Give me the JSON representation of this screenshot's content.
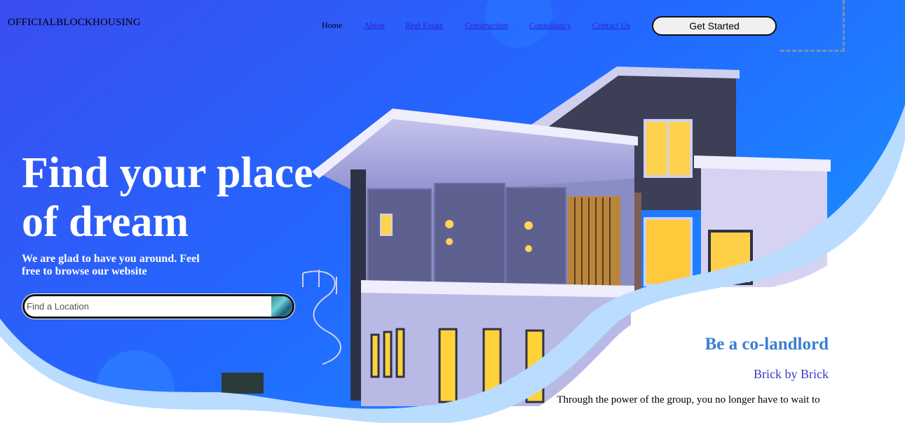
{
  "brand": {
    "logo": "OFFICIALBLOCKHOUSING"
  },
  "nav": {
    "items": [
      {
        "label": "Home"
      },
      {
        "label": "About"
      },
      {
        "label": "Real Estate"
      },
      {
        "label": "Construction"
      },
      {
        "label": "Consultancy"
      },
      {
        "label": "Contact Us"
      }
    ],
    "cta": "Get Started"
  },
  "hero": {
    "title": "Find your place of dream",
    "subtitle": "We are glad to have you around. Feel free to browse our website",
    "search": {
      "placeholder": "Find a Location",
      "value": ""
    }
  },
  "info": {
    "title": "Be a co-landlord",
    "subtitle": "Brick by Brick",
    "body": "Through the power of the group, you no longer have to wait to"
  },
  "colors": {
    "hero_blue": "#1f73ff",
    "hero_indigo": "#3a49ee",
    "wave_light": "#b9dcff",
    "title_blue": "#3a7fd0",
    "link_blue": "#2a1fd8"
  }
}
